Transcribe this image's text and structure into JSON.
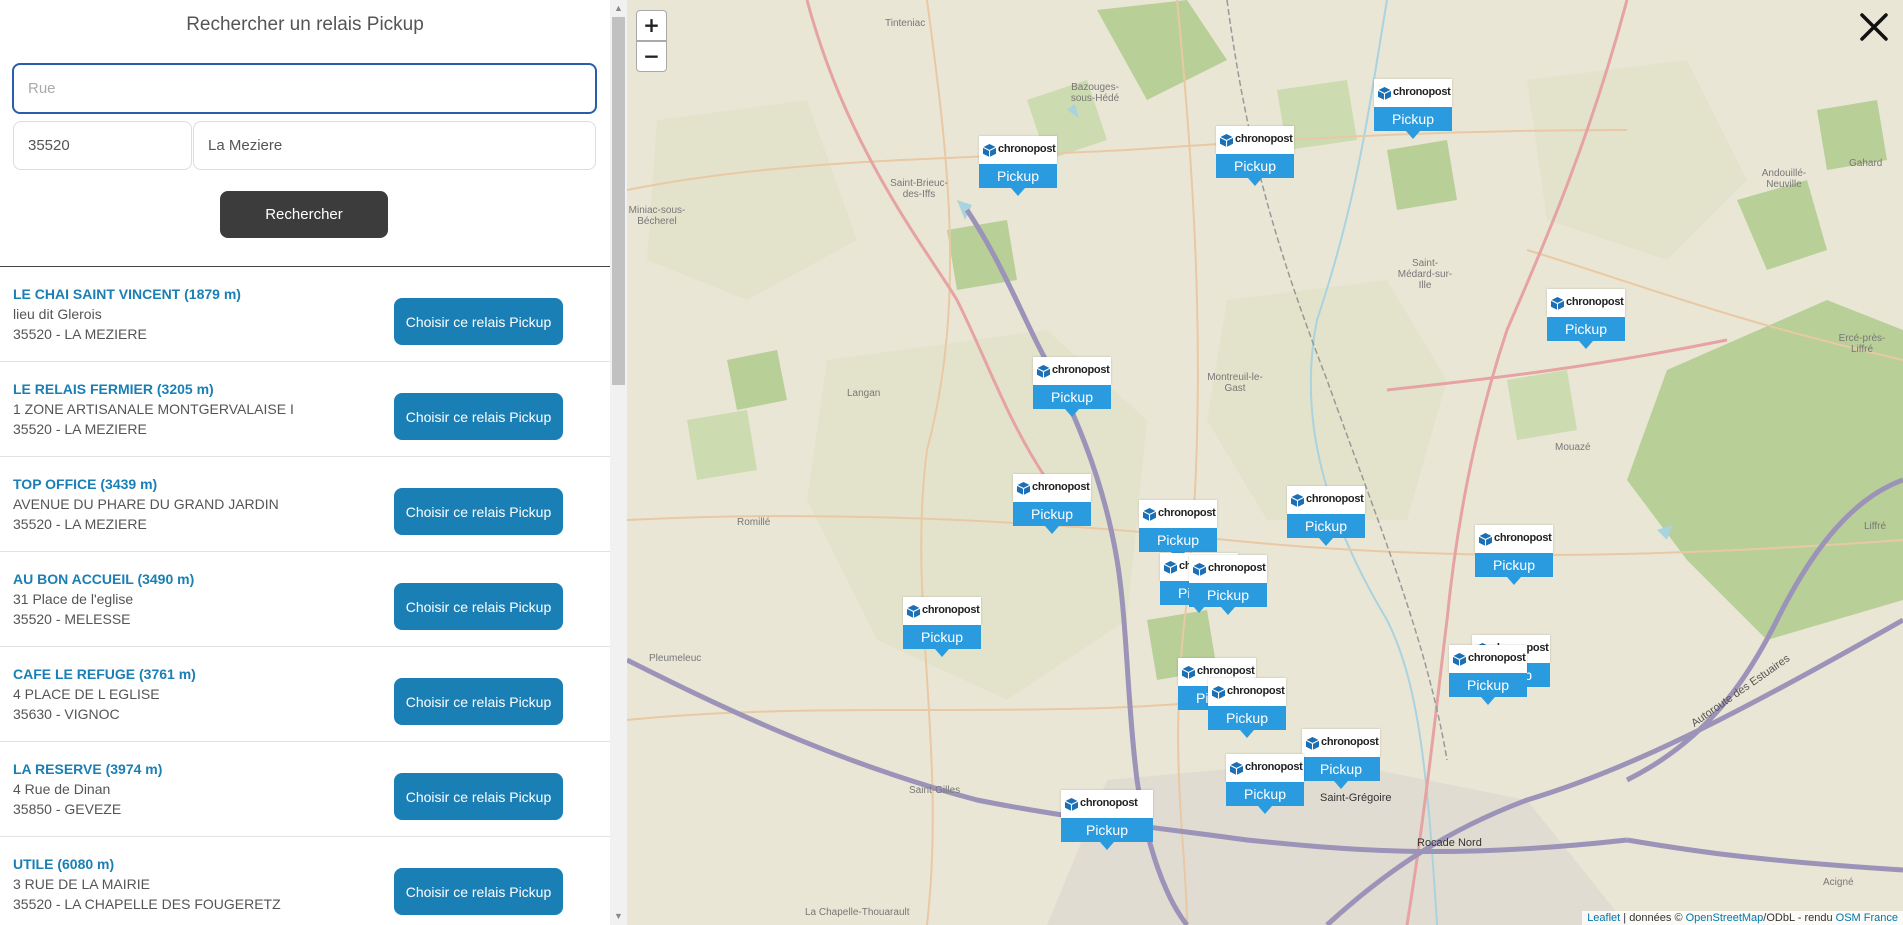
{
  "panel": {
    "title": "Rechercher un relais Pickup",
    "street_placeholder": "Rue",
    "zip_value": "35520",
    "city_value": "La Meziere",
    "search_label": "Rechercher"
  },
  "results": [
    {
      "name": "LE CHAI SAINT VINCENT (1879 m)",
      "address": "lieu dit Glerois",
      "city": "35520 - LA MEZIERE",
      "button": "Choisir ce relais Pickup"
    },
    {
      "name": "LE RELAIS FERMIER (3205 m)",
      "address": "1 ZONE ARTISANALE MONTGERVALAISE I",
      "city": "35520 - LA MEZIERE",
      "button": "Choisir ce relais Pickup"
    },
    {
      "name": "TOP OFFICE (3439 m)",
      "address": "AVENUE DU PHARE DU GRAND JARDIN",
      "city": "35520 - LA MEZIERE",
      "button": "Choisir ce relais Pickup"
    },
    {
      "name": "AU BON ACCUEIL (3490 m)",
      "address": "31 Place de l'eglise",
      "city": "35520 - MELESSE",
      "button": "Choisir ce relais Pickup"
    },
    {
      "name": "CAFE LE REFUGE (3761 m)",
      "address": "4 PLACE DE L EGLISE",
      "city": "35630 - VIGNOC",
      "button": "Choisir ce relais Pickup"
    },
    {
      "name": "LA RESERVE (3974 m)",
      "address": "4 Rue de Dinan",
      "city": "35850 - GEVEZE",
      "button": "Choisir ce relais Pickup"
    },
    {
      "name": "UTILE (6080 m)",
      "address": "3 RUE DE LA MAIRIE",
      "city": "35520 - LA CHAPELLE DES FOUGERETZ",
      "button": "Choisir ce relais Pickup"
    }
  ],
  "map": {
    "zoom_in": "+",
    "zoom_out": "−",
    "marker_brand": "chronopost",
    "marker_label": "Pickup",
    "attribution": {
      "leaflet": "Leaflet",
      "sep1": " | données © ",
      "osm": "OpenStreetMap",
      "mid": "/ODbL - rendu ",
      "osmfr": "OSM France"
    },
    "places": [
      "Tinteniac",
      "Bazouges-sous-Hédé",
      "Saint-Brieuc-des-Iffs",
      "Miniac-sous-Bécherel",
      "Saint-Médard-sur-Ille",
      "Andouillé-Neuville",
      "Gahard",
      "Langan",
      "Montreuil-le-Gast",
      "Ercé-près-Liffré",
      "Mouazé",
      "Romillé",
      "Liffré",
      "Pleumeleuc",
      "Saint-Grégoire",
      "Saint-Gilles",
      "Rocade Nord",
      "Autoroute des Estuaires",
      "La Chapelle-Thouarault",
      "Acigné"
    ]
  }
}
